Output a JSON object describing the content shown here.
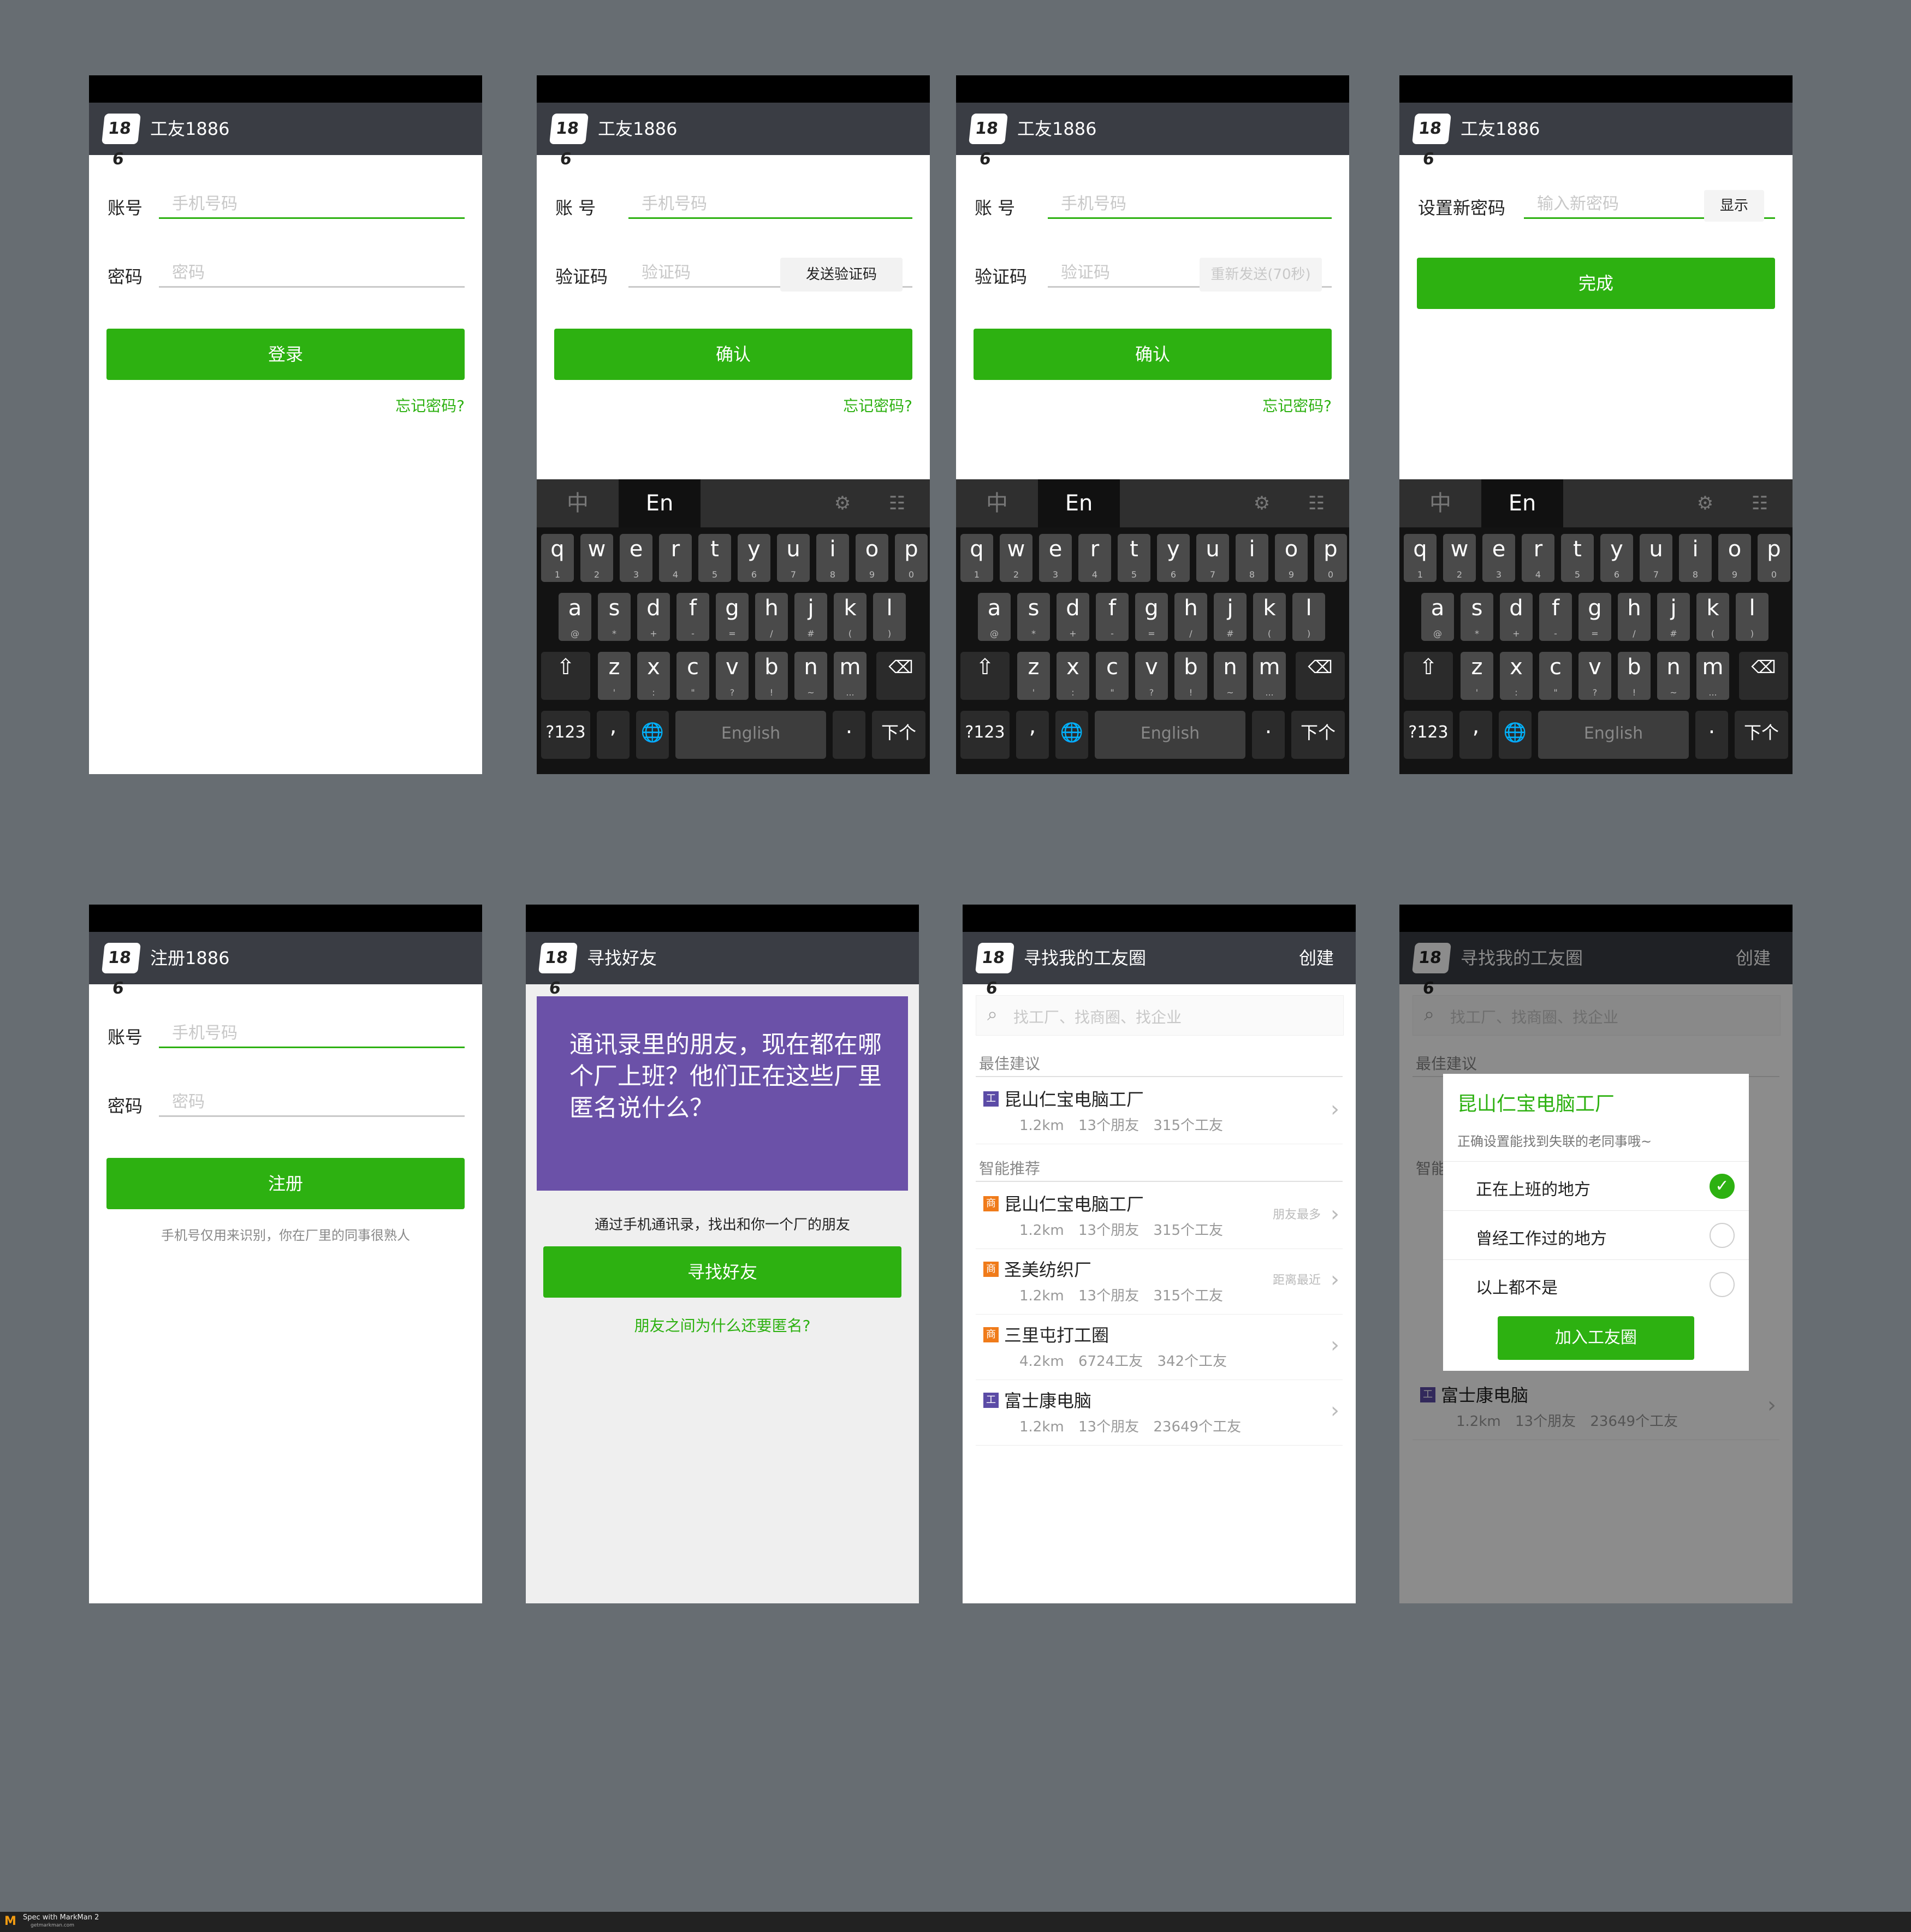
{
  "login": {
    "title": "工友1886",
    "account_label": "账号",
    "account_placeholder": "手机号码",
    "password_label": "密码",
    "password_placeholder": "密码",
    "login_button": "登录",
    "forgot_link": "忘记密码?"
  },
  "verify": {
    "title": "工友1886",
    "account_label": "账  号",
    "account_placeholder": "手机号码",
    "code_label": "验证码",
    "code_placeholder": "验证码",
    "send_code_button": "发送验证码",
    "resend_button": "重新发送(70秒)",
    "confirm_button": "确认",
    "forgot_link": "忘记密码?"
  },
  "reset": {
    "title": "工友1886",
    "new_password_label": "设置新密码",
    "new_password_placeholder": "输入新密码",
    "show_button": "显示",
    "done_button": "完成"
  },
  "keyboard": {
    "lang_zh": "中",
    "lang_en": "En",
    "row1": [
      {
        "main": "q",
        "sub": "1"
      },
      {
        "main": "w",
        "sub": "2"
      },
      {
        "main": "e",
        "sub": "3"
      },
      {
        "main": "r",
        "sub": "4"
      },
      {
        "main": "t",
        "sub": "5"
      },
      {
        "main": "y",
        "sub": "6"
      },
      {
        "main": "u",
        "sub": "7"
      },
      {
        "main": "i",
        "sub": "8"
      },
      {
        "main": "o",
        "sub": "9"
      },
      {
        "main": "p",
        "sub": "0"
      }
    ],
    "row2": [
      {
        "main": "a",
        "sub": "@"
      },
      {
        "main": "s",
        "sub": "*"
      },
      {
        "main": "d",
        "sub": "+"
      },
      {
        "main": "f",
        "sub": "-"
      },
      {
        "main": "g",
        "sub": "="
      },
      {
        "main": "h",
        "sub": "/"
      },
      {
        "main": "j",
        "sub": "#"
      },
      {
        "main": "k",
        "sub": "("
      },
      {
        "main": "l",
        "sub": ")"
      }
    ],
    "row3": [
      {
        "main": "z",
        "sub": "'"
      },
      {
        "main": "x",
        "sub": ":"
      },
      {
        "main": "c",
        "sub": "\""
      },
      {
        "main": "v",
        "sub": "?"
      },
      {
        "main": "b",
        "sub": "!"
      },
      {
        "main": "n",
        "sub": "~"
      },
      {
        "main": "m",
        "sub": "..."
      }
    ],
    "symbols_key": "?123",
    "comma_key": ",",
    "space_key": "English",
    "period_key": ".",
    "next_key": "下个"
  },
  "register": {
    "title": "注册1886",
    "account_label": "账号",
    "account_placeholder": "手机号码",
    "password_label": "密码",
    "password_placeholder": "密码",
    "register_button": "注册",
    "hint": "手机号仅用来识别，你在厂里的同事很熟人"
  },
  "find_friends": {
    "title": "寻找好友",
    "card_text": "通讯录里的朋友，现在都在哪个厂上班？他们正在这些厂里匿名说什么？",
    "info": "通过手机通讯录，找出和你一个厂的朋友",
    "find_button": "寻找好友",
    "why_link": "朋友之间为什么还要匿名?"
  },
  "circles": {
    "title": "寻找我的工友圈",
    "create": "创建",
    "search_placeholder": "找工厂、找商圈、找企业",
    "best_header": "最佳建议",
    "smart_header": "智能推荐",
    "best": [
      {
        "badge": "工",
        "badge_color": "#5b4ba6",
        "name": "昆山仁宝电脑工厂",
        "distance": "1.2km",
        "friends": "13个朋友",
        "workers": "315个工友",
        "tag": ""
      }
    ],
    "smart": [
      {
        "badge": "商",
        "badge_color": "#f07b1a",
        "name": "昆山仁宝电脑工厂",
        "distance": "1.2km",
        "friends": "13个朋友",
        "workers": "315个工友",
        "tag": "朋友最多"
      },
      {
        "badge": "商",
        "badge_color": "#f07b1a",
        "name": "圣美纺织厂",
        "distance": "1.2km",
        "friends": "13个朋友",
        "workers": "315个工友",
        "tag": "距离最近"
      },
      {
        "badge": "商",
        "badge_color": "#f07b1a",
        "name": "三里屯打工圈",
        "distance": "4.2km",
        "friends": "6724工友",
        "workers": "342个工友",
        "tag": ""
      },
      {
        "badge": "工",
        "badge_color": "#5b4ba6",
        "name": "富士康电脑",
        "distance": "1.2km",
        "friends": "13个朋友",
        "workers": "23649个工友",
        "tag": ""
      }
    ]
  },
  "dialog": {
    "factory_name": "昆山仁宝电脑工厂",
    "subtitle": "正确设置能找到失联的老同事哦~",
    "options": [
      "正在上班的地方",
      "曾经工作过的地方",
      "以上都不是"
    ],
    "selected_index": 0,
    "join_button": "加入工友圈",
    "bg_row_name": "富士康电脑",
    "bg_row_distance": "1.2km",
    "bg_row_friends": "13个朋友",
    "bg_row_workers": "23649个工友",
    "bg_best_header": "最佳建议",
    "bg_smart_header": "智能"
  },
  "footer": {
    "brand": "Spec with MarkMan 2",
    "url": "getmarkman.com"
  },
  "colors": {
    "accent_green": "#2db111",
    "titlebar": "#3a3d44",
    "canvas_bg": "#676d72",
    "purple_card": "#6b51a8"
  }
}
